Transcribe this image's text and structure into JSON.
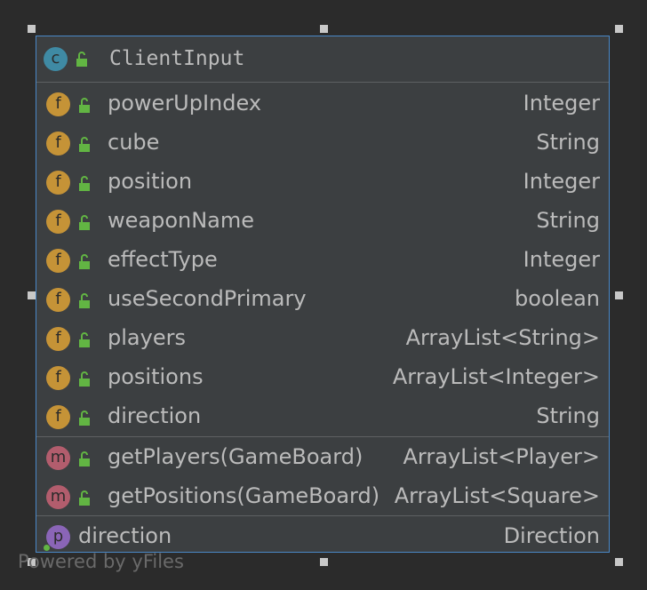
{
  "class": {
    "name": "ClientInput",
    "kind": "c",
    "kind_icon": "class-icon"
  },
  "fields": [
    {
      "name": "powerUpIndex",
      "type": "Integer"
    },
    {
      "name": "cube",
      "type": "String"
    },
    {
      "name": "position",
      "type": "Integer"
    },
    {
      "name": "weaponName",
      "type": "String"
    },
    {
      "name": "effectType",
      "type": "Integer"
    },
    {
      "name": "useSecondPrimary",
      "type": "boolean"
    },
    {
      "name": "players",
      "type": "ArrayList<String>"
    },
    {
      "name": "positions",
      "type": "ArrayList<Integer>"
    },
    {
      "name": "direction",
      "type": "String"
    }
  ],
  "methods": [
    {
      "name": "getPlayers(GameBoard)",
      "type": "ArrayList<Player>"
    },
    {
      "name": "getPositions(GameBoard)",
      "type": "ArrayList<Square>"
    }
  ],
  "properties": [
    {
      "name": "direction",
      "type": "Direction"
    }
  ],
  "badges": {
    "field": "f",
    "method": "m",
    "property": "p"
  },
  "watermark": "Powered by yFiles",
  "colors": {
    "border": "#4a88c7",
    "class_badge": "#3f8aa4",
    "field_badge": "#c59337",
    "method_badge": "#b25d6d",
    "property_badge": "#8a65b7",
    "lock": "#62b543"
  }
}
